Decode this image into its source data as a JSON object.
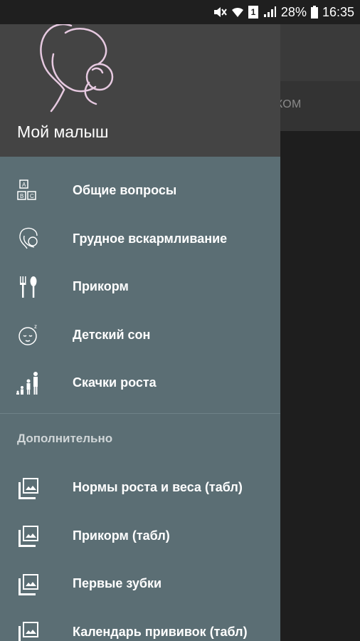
{
  "status_bar": {
    "battery": "28%",
    "time": "16:35",
    "sim_badge": "1",
    "icons": [
      "mute-icon",
      "wifi-icon",
      "sim-icon",
      "signal-icon",
      "battery-icon"
    ]
  },
  "background": {
    "tab_partial": "НКОМ"
  },
  "drawer": {
    "title": "Мой малыш",
    "logo": "mother-baby-logo",
    "items": [
      {
        "label": "Общие вопросы",
        "icon": "abc-blocks-icon"
      },
      {
        "label": "Грудное вскармливание",
        "icon": "breastfeeding-icon"
      },
      {
        "label": "Прикорм",
        "icon": "fork-spoon-icon"
      },
      {
        "label": "Детский сон",
        "icon": "sleeping-baby-icon"
      },
      {
        "label": "Скачки роста",
        "icon": "growth-icon"
      }
    ],
    "section_title": "Дополнительно",
    "extra_items": [
      {
        "label": "Нормы роста и веса (табл)",
        "icon": "image-icon"
      },
      {
        "label": "Прикорм (табл)",
        "icon": "image-icon"
      },
      {
        "label": "Первые зубки",
        "icon": "image-icon"
      },
      {
        "label": "Календарь прививок (табл)",
        "icon": "image-icon"
      }
    ]
  },
  "colors": {
    "drawer_bg": "#5b6e74",
    "header_bg": "#444444",
    "logo_color": "#e6c9e0"
  }
}
